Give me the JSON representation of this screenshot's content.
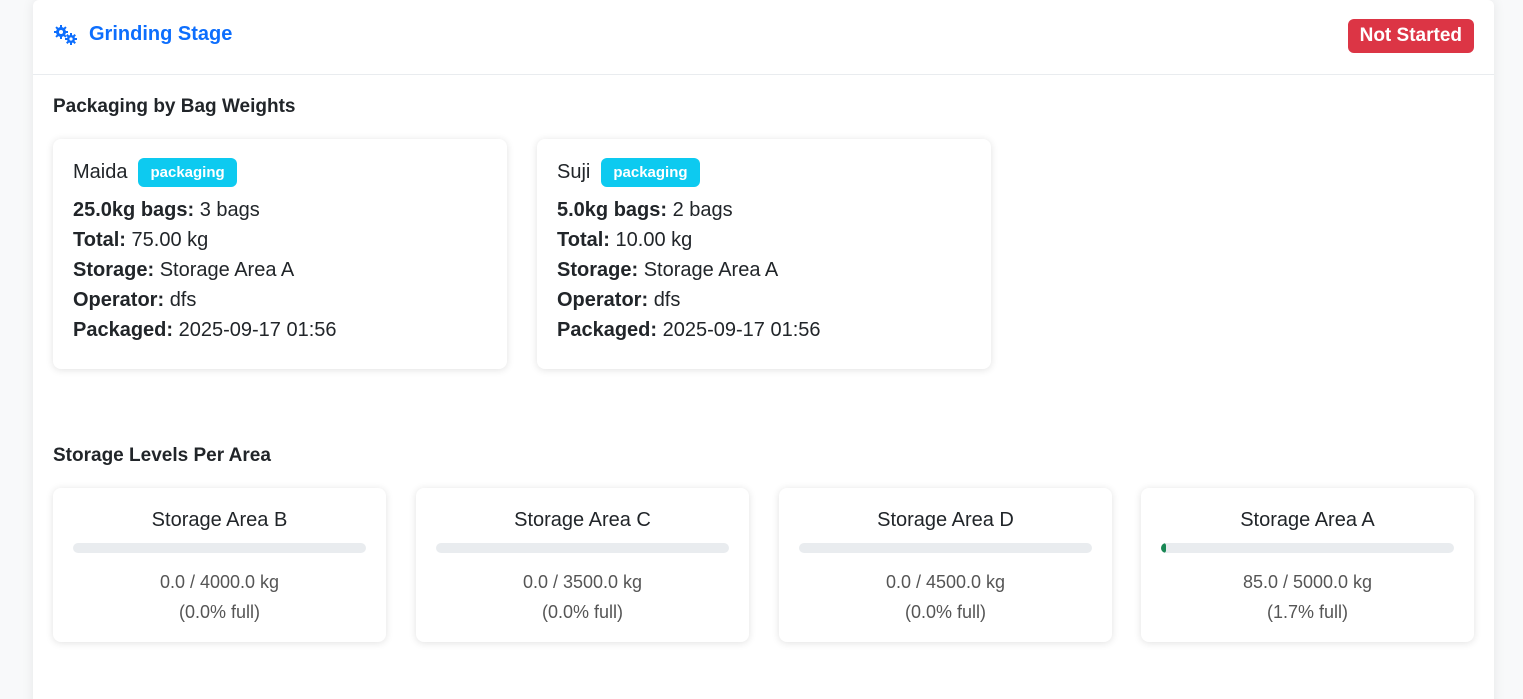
{
  "header": {
    "title": "Grinding Stage",
    "status": "Not Started",
    "status_color": "#dc3545",
    "icon": "gears-icon"
  },
  "packaging": {
    "section_title": "Packaging by Bag Weights",
    "labels": {
      "total": "Total:",
      "storage": "Storage:",
      "operator": "Operator:",
      "packaged": "Packaged:"
    },
    "items": [
      {
        "name": "Maida",
        "badge": "packaging",
        "bag_label": "25.0kg bags:",
        "bag_value": "3 bags",
        "total": "75.00 kg",
        "storage": "Storage Area A",
        "operator": "dfs",
        "packaged": "2025-09-17 01:56"
      },
      {
        "name": "Suji",
        "badge": "packaging",
        "bag_label": "5.0kg bags:",
        "bag_value": "2 bags",
        "total": "10.00 kg",
        "storage": "Storage Area A",
        "operator": "dfs",
        "packaged": "2025-09-17 01:56"
      }
    ]
  },
  "storage": {
    "section_title": "Storage Levels Per Area",
    "areas": [
      {
        "name": "Storage Area B",
        "amount": "0.0 / 4000.0 kg",
        "pct_text": "(0.0% full)",
        "fill_percent": 0.0
      },
      {
        "name": "Storage Area C",
        "amount": "0.0 / 3500.0 kg",
        "pct_text": "(0.0% full)",
        "fill_percent": 0.0
      },
      {
        "name": "Storage Area D",
        "amount": "0.0 / 4500.0 kg",
        "pct_text": "(0.0% full)",
        "fill_percent": 0.0
      },
      {
        "name": "Storage Area A",
        "amount": "85.0 / 5000.0 kg",
        "pct_text": "(1.7% full)",
        "fill_percent": 1.7
      }
    ],
    "bar_color": "#198754"
  }
}
